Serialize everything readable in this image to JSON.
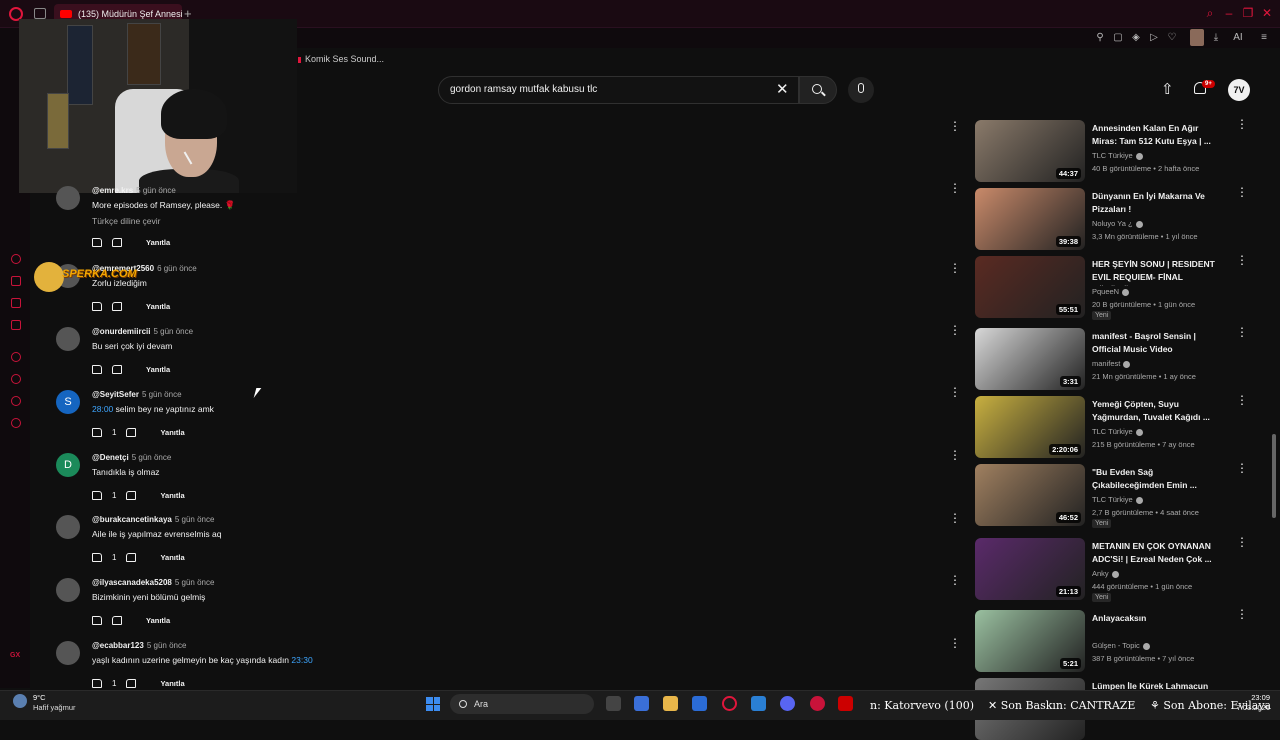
{
  "browser": {
    "tab_title": "(135) Müdürün Şef Annesi",
    "bookmark": "Komik Ses Sound...",
    "ai_label": "AI"
  },
  "youtube": {
    "search_value": "gordon ramsay mutfak kabusu tlc",
    "notif_badge": "9+"
  },
  "sticker_text": "SPERKA.COM",
  "comments": [
    {
      "user": "@emre.krs",
      "date": "5 gün önce",
      "text": "More episodes of Ramsey, please. 🌹",
      "translate": "Türkçe diline çevir",
      "likes": "",
      "reply": "Yanıtla",
      "avatar": ""
    },
    {
      "user": "@emremert2560",
      "date": "6 gün önce",
      "text": "Zorlu izlediğim",
      "likes": "",
      "reply": "Yanıtla",
      "avatar": ""
    },
    {
      "user": "@onurdemiircii",
      "date": "5 gün önce",
      "text": "Bu seri çok iyi devam",
      "likes": "",
      "reply": "Yanıtla",
      "avatar": ""
    },
    {
      "user": "@SeyitSefer",
      "date": "5 gün önce",
      "ts": "28:00",
      "text": " selim bey ne yaptınız amk",
      "likes": "1",
      "reply": "Yanıtla",
      "avatar": "S"
    },
    {
      "user": "@Denetçi",
      "date": "5 gün önce",
      "text": "Tanıdıkla iş olmaz",
      "likes": "1",
      "reply": "Yanıtla",
      "avatar": "D"
    },
    {
      "user": "@burakcancetinkaya",
      "date": "5 gün önce",
      "text": "Aile ile iş yapılmaz evrenselmis aq",
      "likes": "1",
      "reply": "Yanıtla",
      "avatar": ""
    },
    {
      "user": "@ilyascanadeka5208",
      "date": "5 gün önce",
      "text": "Bizimkinin yeni bölümü gelmiş",
      "likes": "",
      "reply": "Yanıtla",
      "avatar": ""
    },
    {
      "user": "@ecabbar123",
      "date": "5 gün önce",
      "text": "yaşlı kadının uzerine gelmeyin be kaç yaşında kadın ",
      "ts2": "23:30",
      "likes": "1",
      "reply": "Yanıtla",
      "avatar": ""
    }
  ],
  "recommendations": [
    {
      "title": "Annesinden Kalan En Ağır Miras: Tam 512 Kutu Eşya | ...",
      "channel": "TLC Türkiye",
      "stats": "40 B görüntüleme • 2 hafta önce",
      "duration": "44:37",
      "new": "",
      "color": "#8a7a6a"
    },
    {
      "title": "Dünyanın En İyi Makarna Ve Pizzaları !",
      "channel": "Noluyo Ya ¿",
      "stats": "3,3 Mn görüntüleme • 1 yıl önce",
      "duration": "39:38",
      "new": "",
      "color": "#c98a6a"
    },
    {
      "title": "HER ŞEYİN SONU | RESIDENT EVIL REQUIEM- FİNAL BÖLÜMÜ",
      "channel": "PqueeN",
      "stats": "20 B görüntüleme • 1 gün önce",
      "duration": "55:51",
      "new": "Yeni",
      "color": "#5a2a22"
    },
    {
      "title": "manifest - Başrol Sensin | Official Music Video",
      "channel": "manifest",
      "stats": "21 Mn görüntüleme • 1 ay önce",
      "duration": "3:31",
      "new": "",
      "color": "#d8d8d8"
    },
    {
      "title": "Yemeği Çöpten, Suyu Yağmurdan, Tuvalet Kağıdı ...",
      "channel": "TLC Türkiye",
      "stats": "215 B görüntüleme • 7 ay önce",
      "duration": "2:20:06",
      "new": "",
      "color": "#c8b040"
    },
    {
      "title": "\"Bu Evden Sağ Çıkabileceğimden Emin ...",
      "channel": "TLC Türkiye",
      "stats": "2,7 B görüntüleme • 4 saat önce",
      "duration": "46:52",
      "new": "Yeni",
      "color": "#a08060"
    },
    {
      "title": "METANIN EN ÇOK OYNANAN ADC'Si! | Ezreal Neden Çok ...",
      "channel": "Anky",
      "stats": "444 görüntüleme • 1 gün önce",
      "duration": "21:13",
      "new": "Yeni",
      "color": "#5a2a6a"
    },
    {
      "title": "Anlayacaksın",
      "channel": "Gülşen - Topic",
      "stats": "387 B görüntüleme • 7 yıl önce",
      "duration": "5:21",
      "new": "",
      "color": "#9ac0a0"
    },
    {
      "title": "Lümpen İle Kürek Lahmacun",
      "channel": "",
      "stats": "",
      "duration": "",
      "new": "",
      "color": "#777"
    }
  ],
  "taskbar": {
    "temp": "9°C",
    "weather": "Hafif yağmur",
    "search": "Ara",
    "ticker1": "n: Katorvevo (100)",
    "ticker2": "Son Baskın: CANTRAZE",
    "ticker3": "Son Abone: Evilaya",
    "time": "23:09",
    "date": "7.03.2026"
  }
}
